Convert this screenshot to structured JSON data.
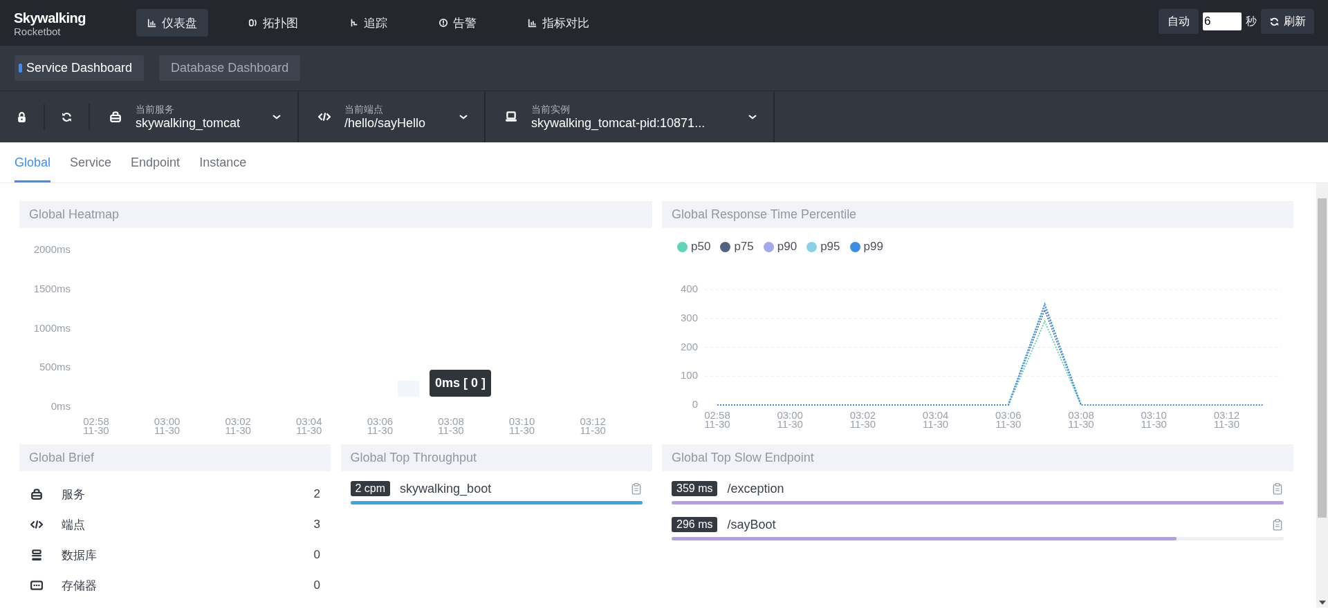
{
  "brand": {
    "title": "Skywalking",
    "subtitle": "Rocketbot"
  },
  "nav": [
    {
      "kind": "dashboard",
      "label": "仪表盘",
      "selected": true
    },
    {
      "kind": "topology",
      "label": "拓扑图",
      "selected": false
    },
    {
      "kind": "trace",
      "label": "追踪",
      "selected": false
    },
    {
      "kind": "alarm",
      "label": "告警",
      "selected": false
    },
    {
      "kind": "comparison",
      "label": "指标对比",
      "selected": false
    }
  ],
  "refresh": {
    "auto_label": "自动",
    "interval": "6",
    "unit": "秒",
    "refresh_label": "刷新"
  },
  "dashboards": [
    {
      "label": "Service Dashboard",
      "selected": true
    },
    {
      "label": "Database Dashboard",
      "selected": false
    }
  ],
  "selectors": [
    {
      "kind": "service",
      "caption": "当前服务",
      "value": "skywalking_tomcat"
    },
    {
      "kind": "endpoint",
      "caption": "当前端点",
      "value": "/hello/sayHello"
    },
    {
      "kind": "instance",
      "caption": "当前实例",
      "value": "skywalking_tomcat-pid:10871..."
    }
  ],
  "tabs": [
    {
      "label": "Global",
      "selected": true
    },
    {
      "label": "Service",
      "selected": false
    },
    {
      "label": "Endpoint",
      "selected": false
    },
    {
      "label": "Instance",
      "selected": false
    }
  ],
  "heatmap": {
    "title": "Global Heatmap",
    "y_labels": [
      "2000ms",
      "1500ms",
      "1000ms",
      "500ms",
      "0ms"
    ],
    "x_labels": [
      {
        "time": "02:58",
        "date": "11-30"
      },
      {
        "time": "03:00",
        "date": "11-30"
      },
      {
        "time": "03:02",
        "date": "11-30"
      },
      {
        "time": "03:04",
        "date": "11-30"
      },
      {
        "time": "03:06",
        "date": "11-30"
      },
      {
        "time": "03:08",
        "date": "11-30"
      },
      {
        "time": "03:10",
        "date": "11-30"
      },
      {
        "time": "03:12",
        "date": "11-30"
      }
    ],
    "tooltip": "0ms [ 0 ]"
  },
  "percentile": {
    "title": "Global Response Time Percentile",
    "chart_data": {
      "type": "line",
      "categories": [
        "02:58\n11-30",
        null,
        "03:00\n11-30",
        null,
        "03:02\n11-30",
        null,
        "03:04\n11-30",
        null,
        "03:06\n11-30",
        null,
        "03:08\n11-30",
        null,
        "03:10\n11-30",
        null,
        "03:12\n11-30",
        null
      ],
      "series": [
        {
          "name": "p50",
          "color": "#5fd4b7",
          "line_style": "dotted",
          "values": [
            null,
            null,
            null,
            null,
            null,
            null,
            null,
            null,
            0,
            290,
            0,
            null,
            null,
            null,
            null,
            null
          ]
        },
        {
          "name": "p75",
          "color": "#55627f",
          "line_style": "dotted",
          "values": [
            null,
            null,
            null,
            null,
            null,
            null,
            null,
            null,
            0,
            330,
            0,
            null,
            null,
            null,
            null,
            null
          ]
        },
        {
          "name": "p90",
          "color": "#a3a9ea",
          "line_style": "dotted",
          "values": [
            null,
            null,
            null,
            null,
            null,
            null,
            null,
            null,
            0,
            340,
            0,
            null,
            null,
            null,
            null,
            null
          ]
        },
        {
          "name": "p95",
          "color": "#86d3e6",
          "line_style": "dotted",
          "values": [
            null,
            null,
            null,
            null,
            null,
            null,
            null,
            null,
            0,
            345,
            0,
            null,
            null,
            null,
            null,
            null
          ]
        },
        {
          "name": "p99",
          "color": "#3a8ee6",
          "line_style": "dotted",
          "values": [
            0,
            0,
            0,
            0,
            0,
            0,
            0,
            0,
            0,
            350,
            0,
            0,
            0,
            0,
            0,
            0
          ]
        }
      ],
      "ylim": [
        0,
        400
      ],
      "yticks": [
        0,
        100,
        200,
        300,
        400
      ],
      "grid": true
    }
  },
  "brief": {
    "title": "Global Brief",
    "items": [
      {
        "kind": "service",
        "label": "服务",
        "count": "2"
      },
      {
        "kind": "endpoint",
        "label": "端点",
        "count": "3"
      },
      {
        "kind": "database",
        "label": "数据库",
        "count": "0"
      },
      {
        "kind": "storage",
        "label": "存储器",
        "count": "0"
      }
    ]
  },
  "throughput": {
    "title": "Global Top Throughput",
    "items": [
      {
        "value": "2 cpm",
        "name": "skywalking_boot",
        "level": 1
      }
    ]
  },
  "slow": {
    "title": "Global Top Slow Endpoint",
    "items": [
      {
        "value": "359 ms",
        "name": "/exception",
        "level": 1
      },
      {
        "value": "296 ms",
        "name": "/sayBoot",
        "level": 0.825
      }
    ]
  }
}
